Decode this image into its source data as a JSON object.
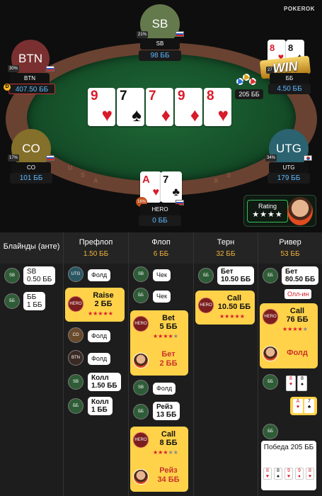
{
  "logo": {
    "text": "POKEROK"
  },
  "table": {
    "rail_text": [
      "U",
      "S",
      "A",
      "A",
      "S"
    ]
  },
  "board": [
    {
      "rank": "9",
      "suit": "♥",
      "color": "red"
    },
    {
      "rank": "7",
      "suit": "♠",
      "color": "blk"
    },
    {
      "rank": "7",
      "suit": "♦",
      "color": "red"
    },
    {
      "rank": "9",
      "suit": "♦",
      "color": "red"
    },
    {
      "rank": "8",
      "suit": "♥",
      "color": "red"
    }
  ],
  "pot": "205 ББ",
  "win_badge": "WIN",
  "seats": {
    "sb": {
      "label": "SB",
      "name": "SB",
      "stack": "98 ББ",
      "pct": "21%"
    },
    "btn": {
      "label": "BTN",
      "name": "BTN",
      "stack": "407.50 ББ",
      "pct": "30%",
      "dealer": "D"
    },
    "bb": {
      "name": "ББ",
      "stack": "4.50 ББ",
      "pct": "27",
      "cards": [
        {
          "rank": "8",
          "suit": "♥"
        },
        {
          "rank": "8",
          "suit": "♠"
        }
      ]
    },
    "co": {
      "label": "CO",
      "name": "CO",
      "stack": "101 ББ",
      "pct": "17%"
    },
    "utg": {
      "label": "UTG",
      "name": "UTG",
      "stack": "179 ББ",
      "pct": "34%"
    },
    "hero": {
      "name": "HERO",
      "stack": "0 ББ",
      "pct": "16%",
      "cards": [
        {
          "rank": "A",
          "suit": "♥"
        },
        {
          "rank": "7",
          "suit": "♣"
        }
      ]
    }
  },
  "rating": {
    "label": "Rating",
    "stars": "★★★★"
  },
  "history": {
    "streets": [
      {
        "title": "Блайнды (анте)",
        "pot": ""
      },
      {
        "title": "Префлоп",
        "pot": "1.50 ББ"
      },
      {
        "title": "Флоп",
        "pot": "6 ББ"
      },
      {
        "title": "Терн",
        "pot": "32 ББ"
      },
      {
        "title": "Ривер",
        "pot": "53 ББ"
      }
    ],
    "blinds": [
      {
        "badge": "SB",
        "l1": "SB",
        "l2": "0.50 ББ"
      },
      {
        "badge": "ББ",
        "l1": "ББ",
        "l2": "1 ББ"
      }
    ],
    "preflop": {
      "utg": {
        "badge": "UTG",
        "text": "Фолд"
      },
      "hero": {
        "badge": "HERO",
        "l1": "Raise",
        "l2": "2 ББ",
        "stars": "★★★★★"
      },
      "co": {
        "badge": "CO",
        "text": "Фолд"
      },
      "btn": {
        "badge": "BTN",
        "text": "Фолд"
      },
      "sb": {
        "badge": "SB",
        "l1": "Колл",
        "l2": "1.50 ББ"
      },
      "bb": {
        "badge": "ББ",
        "l1": "Колл",
        "l2": "1 ББ"
      }
    },
    "flop": {
      "sb": {
        "badge": "SB",
        "text": "Чек"
      },
      "bb": {
        "badge": "ББ",
        "text": "Чек"
      },
      "hero": {
        "badge": "HERO",
        "l1": "Bet",
        "l2": "5 ББ",
        "stars": "★★★★",
        "stars_grey": "★",
        "r1": "Бет",
        "r2": "2 ББ"
      },
      "sb2": {
        "badge": "SB",
        "text": "Фолд"
      },
      "bb2": {
        "badge": "ББ",
        "l1": "Рейз",
        "l2": "13 ББ"
      },
      "hero2": {
        "badge": "HERO",
        "l1": "Call",
        "l2": "8 ББ",
        "stars": "★★★",
        "stars_grey": "★★",
        "r1": "Рейз",
        "r2": "34 ББ"
      }
    },
    "turn": {
      "bb": {
        "badge": "ББ",
        "l1": "Бет",
        "l2": "10.50 ББ"
      },
      "hero": {
        "badge": "HERO",
        "l1": "Call",
        "l2": "10.50 ББ",
        "stars": "★★★★★"
      }
    },
    "river": {
      "bb": {
        "badge": "ББ",
        "l1": "Бет",
        "l2": "80.50 ББ",
        "allin": "Олл-ин"
      },
      "hero": {
        "badge": "HERO",
        "l1": "Call",
        "l2": "76 ББ",
        "stars": "★★★★",
        "stars_grey": "★",
        "r1": "Фолд"
      },
      "bb_show": {
        "badge": "ББ",
        "cards": [
          {
            "rank": "8",
            "suit": "♥"
          },
          {
            "rank": "8",
            "suit": "♠"
          }
        ]
      },
      "hero_show": {
        "cards": [
          {
            "rank": "A",
            "suit": "♥"
          },
          {
            "rank": "7",
            "suit": "♣"
          }
        ]
      },
      "result": {
        "badge": "ББ",
        "text": "Победа 205 ББ",
        "cards": [
          {
            "rank": "8",
            "suit": "♥"
          },
          {
            "rank": "8",
            "suit": "♠"
          },
          {
            "rank": "9",
            "suit": "♥"
          },
          {
            "rank": "9",
            "suit": "♦"
          },
          {
            "rank": "8",
            "suit": "♥"
          }
        ]
      }
    }
  }
}
